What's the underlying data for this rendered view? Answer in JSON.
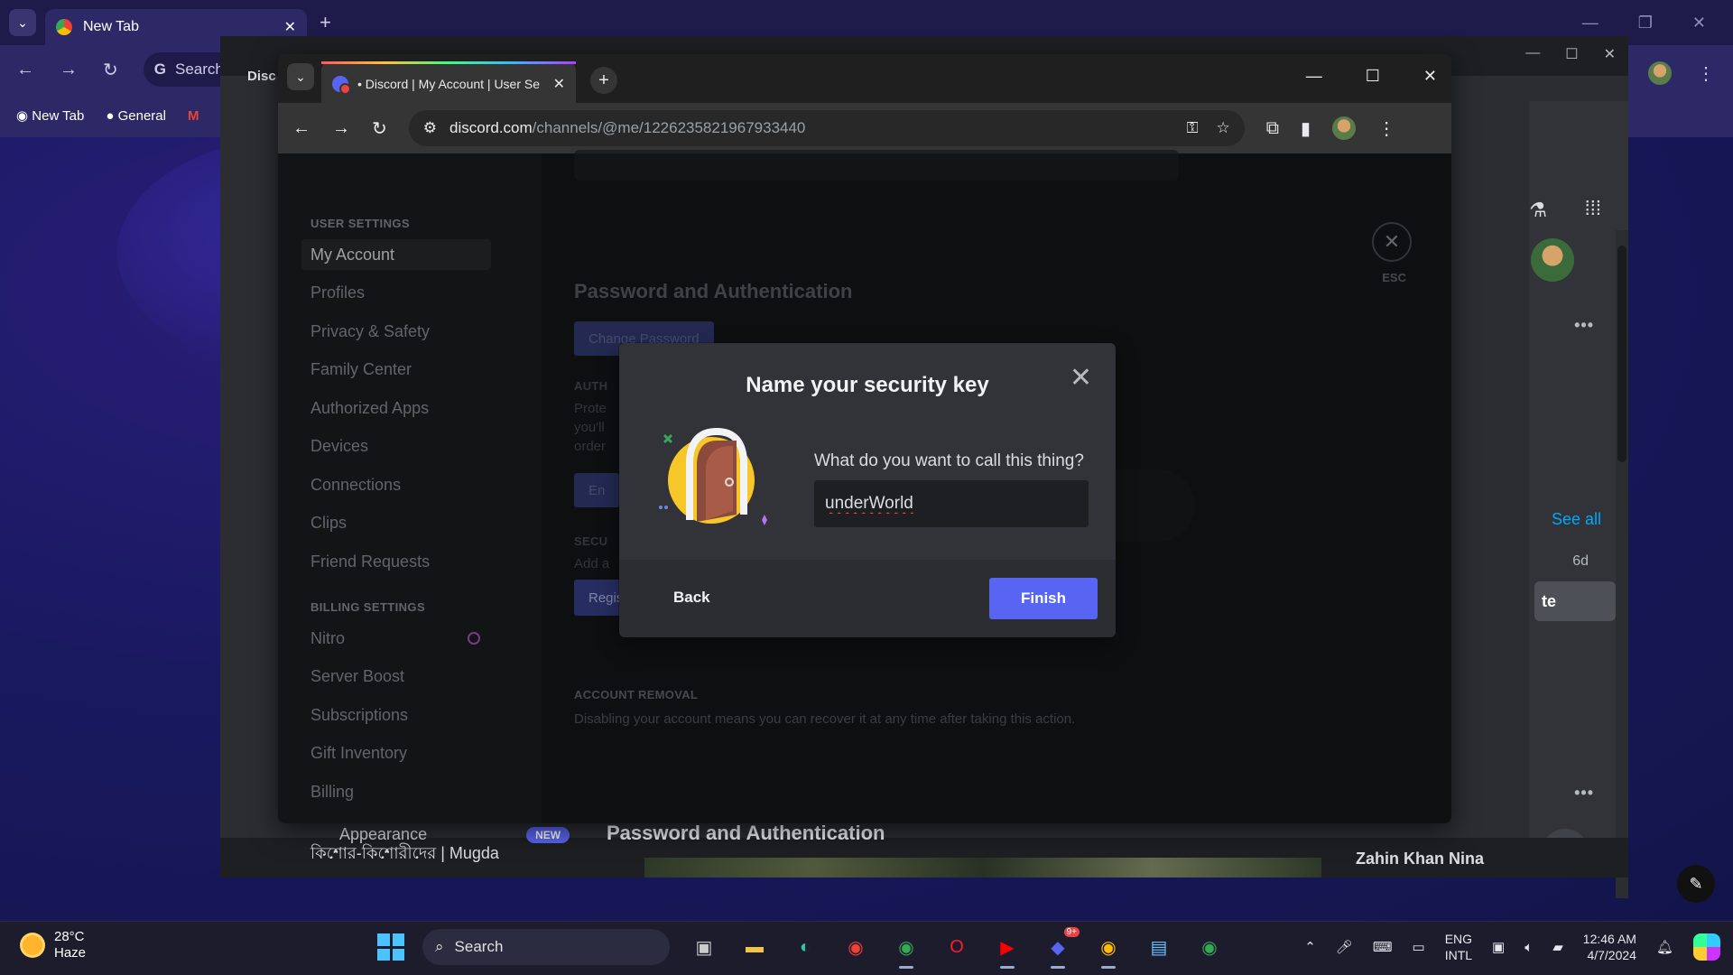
{
  "back_browser": {
    "tab_title": "New Tab",
    "omnibox_text": "Search",
    "bookmarks": [
      "New Tab",
      "General"
    ],
    "middle_tab_fragment": "Disc"
  },
  "middle_window": {
    "see_all": "See all",
    "age": "6d",
    "button_fragment": "te",
    "appearance_label": "Appearance",
    "new_badge": "NEW",
    "bottom_heading": "Password and Authentication",
    "bottom_left_text": "কিশোর-কিশোরীদের | Mugda",
    "bottom_right_text": "Zahin Khan Nina"
  },
  "browser": {
    "tab_title": "• Discord | My Account | User Se",
    "url_domain": "discord.com",
    "url_path": "/channels/@me/1226235821967933440"
  },
  "settings": {
    "user_settings_header": "USER SETTINGS",
    "user_items": [
      "My Account",
      "Profiles",
      "Privacy & Safety",
      "Family Center",
      "Authorized Apps",
      "Devices",
      "Connections",
      "Clips",
      "Friend Requests"
    ],
    "billing_header": "BILLING SETTINGS",
    "billing_items": [
      "Nitro",
      "Server Boost",
      "Subscriptions",
      "Gift Inventory",
      "Billing"
    ],
    "esc_label": "ESC",
    "section_title": "Password and Authentication",
    "change_password": "Change Password",
    "auth_header": "AUTH",
    "auth_text_lines": [
      "Prote",
      "you'll",
      "order"
    ],
    "enable_btn": "En",
    "security_header": "SECU",
    "security_text": "Add a",
    "register_key": "Register a Security Key",
    "account_removal_header": "ACCOUNT REMOVAL",
    "account_removal_text": "Disabling your account means you can recover it at any time after taking this action."
  },
  "modal": {
    "title": "Name your security key",
    "prompt": "What do you want to call this thing?",
    "input_value": "underWorld",
    "back_label": "Back",
    "finish_label": "Finish"
  },
  "taskbar": {
    "temperature": "28°C",
    "weather": "Haze",
    "search_label": "Search",
    "lang_top": "ENG",
    "lang_bottom": "INTL",
    "time": "12:46 AM",
    "date": "4/7/2024",
    "discord_badge": "9+"
  },
  "colors": {
    "discord_blurple": "#5865f2",
    "modal_bg": "#313338",
    "taskbar_bg": "#1c1c2c"
  }
}
